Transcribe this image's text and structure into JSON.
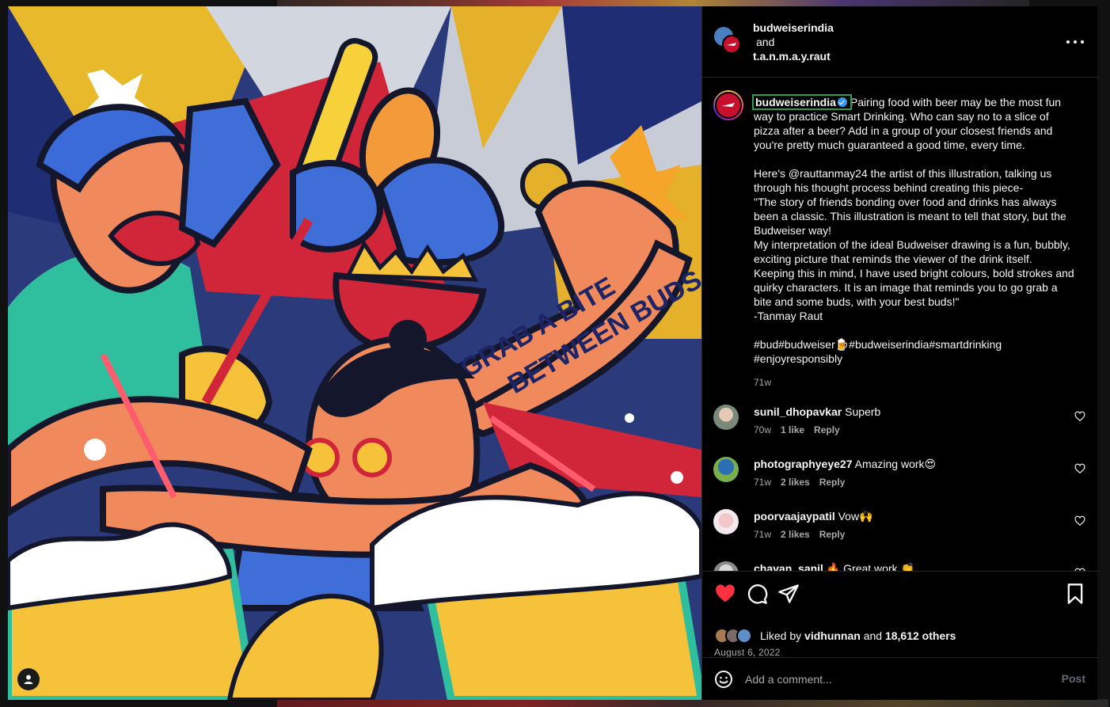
{
  "header": {
    "user1": "budweiserindia",
    "joiner": "and",
    "user2": "t.a.n.m.a.y.raut",
    "more_icon": "more-horizontal-icon"
  },
  "caption": {
    "username": "budweiserindia",
    "paragraph1": "Pairing food with beer may be the most fun way to practice Smart Drinking. Who can say no to a slice of pizza after a beer? Add in a group of your closest friends and you're pretty much guaranteed a good time, every time.",
    "paragraph2": "Here's @rauttanmay24 the artist of this illustration, talking us through his thought process behind creating this piece-\n\"The story of friends bonding over food and drinks has always been a classic. This illustration is meant to tell that story, but the Budweiser way!\nMy interpretation of the ideal Budweiser drawing is a fun, bubbly, exciting picture that reminds the viewer of the drink itself. Keeping this in mind, I have used bright colours, bold strokes and quirky characters. It is an image that reminds you to go grab a bite and some buds, with your best buds!\"\n-Tanmay Raut",
    "hashtags": "#bud#budweiser🍺#budweiserindia#smartdrinking #enjoyresponsibly",
    "time": "71w"
  },
  "comments": [
    {
      "user": "sunil_dhopavkar",
      "text": "Superb",
      "time": "70w",
      "likes": "1 like",
      "reply": "Reply"
    },
    {
      "user": "photographyeye27",
      "text": "Amazing work😍",
      "time": "71w",
      "likes": "2 likes",
      "reply": "Reply"
    },
    {
      "user": "poorvaajaypatil",
      "text": "Vow🙌",
      "time": "71w",
      "likes": "2 likes",
      "reply": "Reply"
    },
    {
      "user": "chavan_sanil",
      "text": "🔥 Great work 👏",
      "time": "",
      "likes": "",
      "reply": ""
    }
  ],
  "post": {
    "liked_prefix": "Liked by",
    "liked_user": "vidhunnan",
    "liked_and": "and",
    "liked_others": "18,612 others",
    "date": "August 6, 2022",
    "comment_placeholder": "Add a comment...",
    "post_label": "Post"
  },
  "media": {
    "banner_line1": "GRAB A BITE",
    "banner_line2": "BETWEEN BUDS"
  },
  "colors": {
    "heart_red": "#ff3040",
    "verified_blue": "#3897f0",
    "post_disabled": "#5f6a75",
    "muted": "#a8a8a8"
  }
}
